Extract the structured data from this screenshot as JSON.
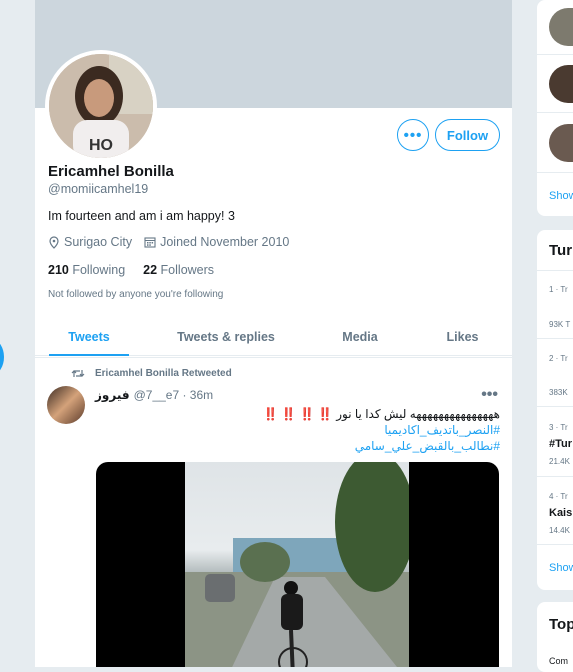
{
  "profile": {
    "display_name": "Ericamhel Bonilla",
    "handle": "@momiicamhel19",
    "bio": "Im fourteen and am i am happy! 3",
    "location": "Surigao City",
    "joined": "Joined November 2010",
    "following_count": "210",
    "following_label": "Following",
    "followers_count": "22",
    "followers_label": "Followers",
    "not_followed": "Not followed by anyone you're following",
    "more_label": "•••",
    "follow_label": "Follow"
  },
  "tabs": [
    "Tweets",
    "Tweets & replies",
    "Media",
    "Likes"
  ],
  "tweet": {
    "retweet_label": "Ericamhel Bonilla Retweeted",
    "name": "فيروز",
    "meta": "@7__e7 · 36m",
    "more": "•••",
    "line1": "هههههههههههههههه ليش كدا يا نور",
    "line1_bangs": "‼️ ‼️ ‼️ ‼️",
    "tag1": "#النصر_باتديف_اكاديميا",
    "tag2": "#نطالب_بالقبض_علي_سامي"
  },
  "sidebar": {
    "show1": "Show",
    "trends_title": "Tur",
    "trend1_meta": "1 · Tr",
    "trend1_count": "93K T",
    "trend2_meta": "2 · Tr",
    "trend2_count": "383K",
    "trend3_meta": "3 · Tr",
    "trend3_name": "#Tur",
    "trend3_count": "21.4K",
    "trend4_meta": "4 · Tr",
    "trend4_name": "Kais",
    "trend4_count": "14.4K",
    "show2": "Show",
    "topics_title": "Top",
    "topics_item": "Com"
  },
  "colors": {
    "accent": "#1da1f2",
    "banner": "#ccd6dd",
    "bg": "#e6ecf0",
    "alert": "#e0245e"
  }
}
